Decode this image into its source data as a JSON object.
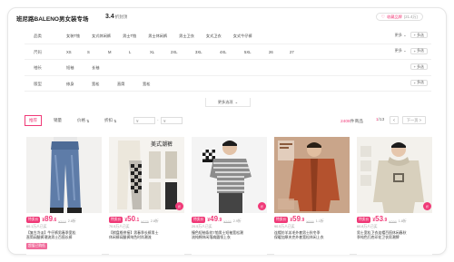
{
  "header": {
    "shop_title": "班尼路BALENO男女装专场",
    "rating": "3.4",
    "rating_unit": "折封顶",
    "fav_label": "收藏品牌",
    "fav_count": "(21.4万)"
  },
  "filters": {
    "rows": [
      {
        "label": "品类",
        "options": [
          "女装T恤",
          "女式休闲裤",
          "男士T恤",
          "男士休闲裤",
          "男士卫衣",
          "女式卫衣",
          "女式牛仔裤"
        ],
        "more": "更多",
        "multi": "多选"
      },
      {
        "label": "尺码",
        "options": [
          "XS",
          "S",
          "M",
          "L",
          "XL",
          "2XL",
          "3XL",
          "4XL",
          "5XL",
          "26",
          "27"
        ],
        "more": "更多",
        "multi": "多选"
      },
      {
        "label": "袖长",
        "options": [
          "短袖",
          "长袖"
        ],
        "more": "",
        "multi": "多选"
      },
      {
        "label": "版型",
        "options": [
          "修身",
          "宽松",
          "直筒",
          "宽松"
        ],
        "more": "",
        "multi": "多选"
      }
    ],
    "more_options": "更多选项"
  },
  "sortbar": {
    "items": [
      "推荐",
      "销量",
      "价格",
      "折扣"
    ],
    "price_from": "¥",
    "price_to": "¥",
    "count_num": "2408",
    "count_unit": "件商品",
    "page_current": "1",
    "page_total": "/13",
    "prev": "<",
    "next": "下一页 >"
  },
  "products": [
    {
      "tag": "特卖价",
      "price_int": "89",
      "price_dec": ".6",
      "orig": "¥319",
      "disc": "2.8折",
      "sold": "60.1万人已买",
      "desc1": "【复古冷淡】牛仔裤男春季宽松",
      "desc2": "直筒阔腿裤潮流男士百搭长裤",
      "badge": "超值已购低"
    },
    {
      "tag": "特卖价",
      "price_int": "50",
      "price_dec": ".1",
      "orig": "¥179",
      "disc": "2.8折",
      "sold": "70.5万人已买",
      "desc1": "【棋盘格拼接】男春季长裤男士",
      "desc2": "休闲裤阔腿裤纯色时尚潮流",
      "badge": ""
    },
    {
      "tag": "特卖价",
      "price_int": "49",
      "price_dec": ".9",
      "orig": "¥169",
      "disc": "2.9折",
      "sold": "20.5万人已买",
      "desc1": "撞色短袖条纹T恤男士短袖宽松潮",
      "desc2": "流纯棉休闲落肩圆领上衣",
      "badge": ""
    },
    {
      "tag": "特卖价",
      "price_int": "59",
      "price_dec": ".9",
      "orig": "¥699",
      "disc": "1.1折",
      "sold": "90.5万人已买",
      "desc1": "连帽仿羊羔毛外套男士秋冬季",
      "desc2": "保暖加厚夹克外套宽松休闲上衣",
      "badge": ""
    },
    {
      "tag": "特卖价",
      "price_int": "53",
      "price_dec": ".9",
      "orig": "¥299",
      "disc": "1.8折",
      "sold": "60.8万人已买",
      "desc1": "男士宽松卫衣连帽百搭休闲春秋",
      "desc2": "季纯色打底印花卫衣男潮牌",
      "badge": ""
    }
  ]
}
